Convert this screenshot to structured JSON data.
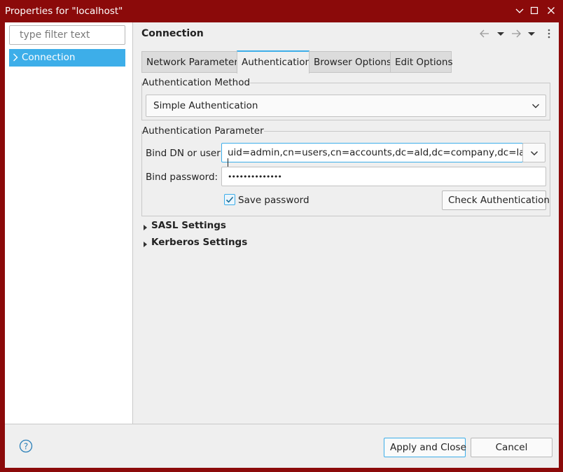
{
  "window": {
    "title": "Properties for \"localhost\"",
    "controls": {
      "minimize_icon": "minimize-icon",
      "maximize_icon": "maximize-icon",
      "close_icon": "close-icon"
    }
  },
  "sidebar": {
    "filter_placeholder": "type filter text",
    "items": [
      {
        "label": "Connection",
        "selected": true
      }
    ]
  },
  "page": {
    "title": "Connection",
    "nav_icons": [
      "back-arrow-icon",
      "dropdown-icon",
      "forward-arrow-icon",
      "dropdown-icon",
      "more-vertical-icon"
    ],
    "tabs": [
      {
        "label": "Network Parameter",
        "active": false
      },
      {
        "label": "Authentication",
        "active": true
      },
      {
        "label": "Browser Options",
        "active": false
      },
      {
        "label": "Edit Options",
        "active": false
      }
    ]
  },
  "auth": {
    "method_group": "Authentication Method",
    "method_value": "Simple Authentication",
    "param_group": "Authentication Parameter",
    "bind_dn_label": "Bind DN or user:",
    "bind_dn_value": "uid=admin,cn=users,cn=accounts,dc=ald,dc=company,dc=lan",
    "bind_password_label": "Bind password:",
    "bind_password_value": "••••••••••••••",
    "save_password_label": "Save password",
    "save_password_checked": true,
    "check_button": "Check Authentication"
  },
  "sections": [
    {
      "label": "SASL Settings",
      "expanded": false
    },
    {
      "label": "Kerberos Settings",
      "expanded": false
    }
  ],
  "footer": {
    "help_icon": "help-icon",
    "apply_close": "Apply and Close",
    "cancel": "Cancel"
  },
  "colors": {
    "titlebar": "#8b0a0a",
    "accent": "#3daee9",
    "background": "#efefef"
  }
}
